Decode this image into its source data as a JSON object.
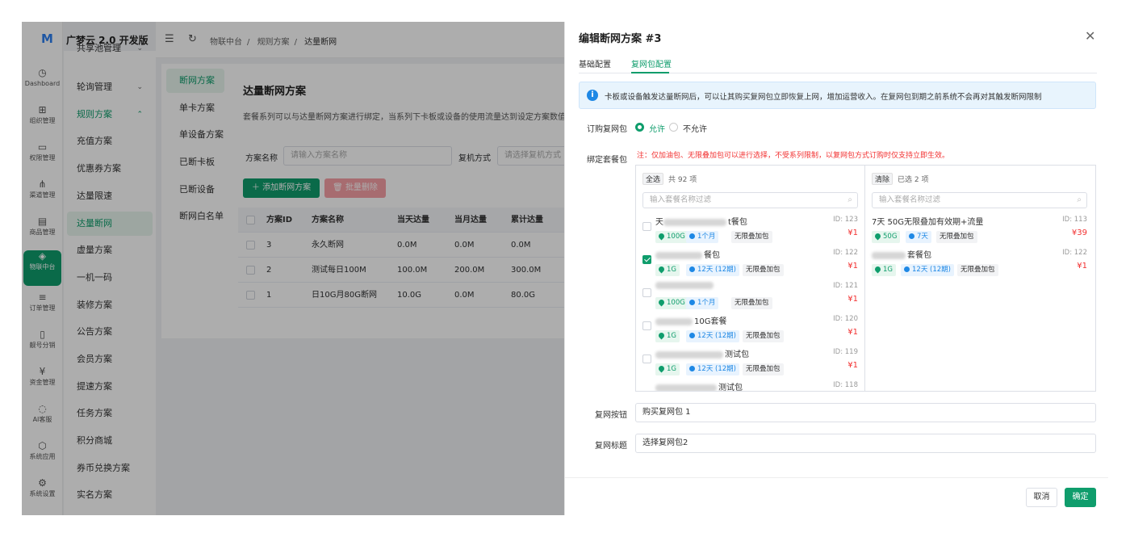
{
  "app": {
    "title": "广梦云 2.0 开发版"
  },
  "rail": [
    {
      "label": "Dashboard",
      "icon": "dashboard-icon"
    },
    {
      "label": "组织管理",
      "icon": "grid-icon"
    },
    {
      "label": "权限管理",
      "icon": "monitor-icon"
    },
    {
      "label": "渠道管理",
      "icon": "network-icon"
    },
    {
      "label": "商品管理",
      "icon": "store-icon"
    },
    {
      "label": "物联中台",
      "icon": "iot-icon",
      "active": true
    },
    {
      "label": "订单管理",
      "icon": "list-icon"
    },
    {
      "label": "靓号分销",
      "icon": "phone-icon"
    },
    {
      "label": "资金管理",
      "icon": "wallet-icon"
    },
    {
      "label": "AI客服",
      "icon": "chat-icon"
    },
    {
      "label": "系统应用",
      "icon": "cube-icon"
    },
    {
      "label": "系统设置",
      "icon": "gear-icon"
    }
  ],
  "submenu": {
    "top_partial": "共享池管理",
    "items": [
      "轮询管理",
      "规则方案",
      "充值方案",
      "优惠券方案",
      "达量限速",
      "达量断网",
      "虚量方案",
      "一机一码",
      "装修方案",
      "公告方案",
      "会员方案",
      "提速方案",
      "任务方案",
      "积分商城",
      "券币兑换方案",
      "实名方案"
    ]
  },
  "breadcrumb": [
    "物联中台",
    "规则方案",
    "达量断网"
  ],
  "content": {
    "tabs": [
      "断网方案",
      "单卡方案",
      "单设备方案",
      "已断卡板",
      "已断设备",
      "断网白名单"
    ],
    "title": "达量断网方案",
    "desc": "套餐系列可以与达量断网方案进行绑定，当系列下卡板或设备的使用流量达到设定方案数值，",
    "filter1_label": "方案名称",
    "filter1_placeholder": "请输入方案名称",
    "filter2_label": "复机方式",
    "filter2_placeholder": "请选择复机方式",
    "add_button": "添加断网方案",
    "delete_button": "批量删除",
    "columns": [
      "方案ID",
      "方案名称",
      "当天达量",
      "当月达量",
      "累计达量"
    ],
    "rows": [
      [
        "3",
        "永久断网",
        "0.0M",
        "0.0M",
        "0.0M"
      ],
      [
        "2",
        "测试每日100M",
        "100.0M",
        "200.0M",
        "300.0M"
      ],
      [
        "1",
        "日10G月80G断网",
        "10.0G",
        "0.0M",
        "80.0G"
      ]
    ]
  },
  "drawer": {
    "title": "编辑断网方案 #3",
    "tabs": [
      "基础配置",
      "复网包配置"
    ],
    "alert": "卡板或设备触发达量断网后，可以让其购买复网包立即恢复上网，增加运营收入。在复网包到期之前系统不会再对其触发断网限制",
    "order_label": "订购复网包",
    "radio_allow": "允许",
    "radio_deny": "不允许",
    "bind_label": "绑定套餐包",
    "note": "注：仅加油包、无限叠加包可以进行选择，不受系列限制，以复网包方式订购时仅支持立即生效。",
    "left_header": {
      "select_all": "全选",
      "count": "共 92 项"
    },
    "right_header": {
      "clear": "清除",
      "count": "已选 2 项"
    },
    "filter_placeholder": "输入套餐名称过滤",
    "left_items": [
      {
        "name_suffix": "t餐包",
        "id": "ID: 123",
        "price": "¥1",
        "flow": "100G",
        "period": "1个月",
        "type": "无限叠加包",
        "checked": false
      },
      {
        "name_suffix": "餐包",
        "id": "ID: 122",
        "price": "¥1",
        "flow": "1G",
        "period": "12天 (12期)",
        "type": "无限叠加包",
        "checked": true
      },
      {
        "name_suffix": "",
        "id": "ID: 121",
        "price": "¥1",
        "flow": "100G",
        "period": "1个月",
        "type": "无限叠加包",
        "checked": false
      },
      {
        "name_suffix": "10G套餐",
        "id": "ID: 120",
        "price": "¥1",
        "flow": "1G",
        "period": "12天 (12期)",
        "type": "无限叠加包",
        "checked": false
      },
      {
        "name_suffix": "测试包",
        "id": "ID: 119",
        "price": "¥1",
        "flow": "1G",
        "period": "12天 (12期)",
        "type": "无限叠加包",
        "checked": false
      },
      {
        "name_suffix": "测试包",
        "id": "ID: 118",
        "price": "",
        "flow": "",
        "period": "",
        "type": "",
        "checked": false
      }
    ],
    "right_items": [
      {
        "name": "7天 50G无限叠加有效期+流量",
        "id": "ID: 113",
        "price": "¥39",
        "flow": "50G",
        "period": "7天",
        "type": "无限叠加包"
      },
      {
        "name": "套餐包",
        "id": "ID: 122",
        "price": "¥1",
        "flow": "1G",
        "period": "12天 (12期)",
        "type": "无限叠加包"
      }
    ],
    "button_label": "复网按钮",
    "button_value": "购买复网包 1",
    "title_label": "复网标题",
    "title_value": "选择复网包2",
    "cancel": "取消",
    "confirm": "确定"
  },
  "colors": {
    "primary": "#0f9d6c",
    "danger": "#f23030",
    "info": "#1e88e5"
  }
}
